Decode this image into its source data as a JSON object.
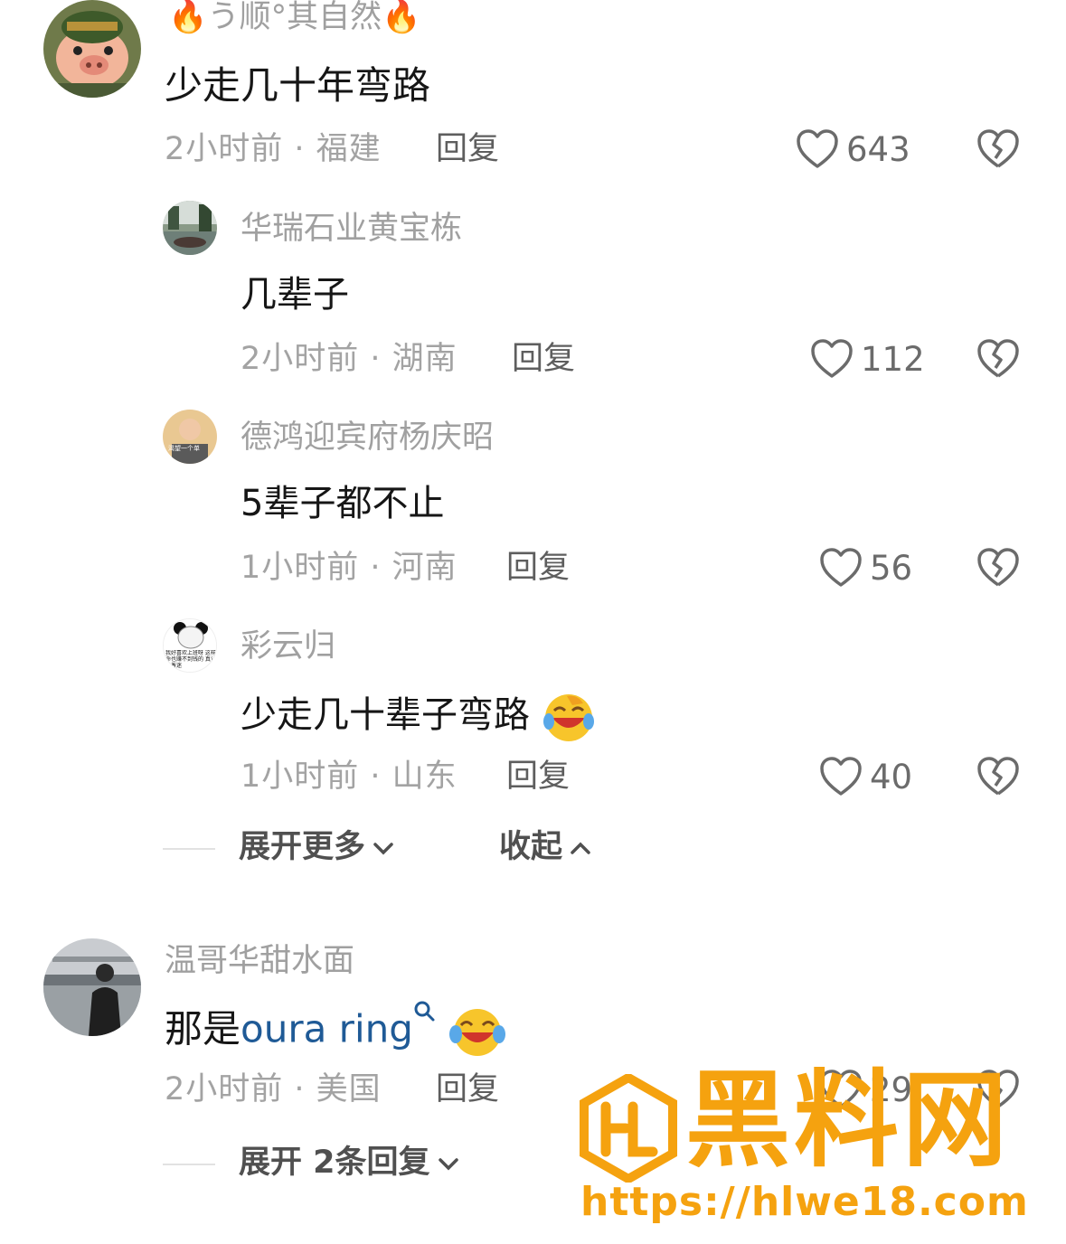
{
  "comments": [
    {
      "username_prefix": "🔥",
      "username": "う顺°其自然",
      "username_suffix": "🔥",
      "content": "少走几十年弯路",
      "meta": "2小时前 · 福建",
      "reply_label": "回复",
      "likes": "643"
    }
  ],
  "replies": [
    {
      "username": "华瑞石业黄宝栋",
      "content": "几辈子",
      "meta": "2小时前 · 湖南",
      "reply_label": "回复",
      "likes": "112"
    },
    {
      "username": "德鸿迎宾府杨庆昭",
      "avatar_caption": "渴望一个单",
      "content": "5辈子都不止",
      "meta": "1小时前 · 河南",
      "reply_label": "回复",
      "likes": "56"
    },
    {
      "username": "彩云归",
      "avatar_caption": "我好喜欢上班呀 这样命也赚不到钱的 真让人着迷",
      "content": "少走几十辈子弯路",
      "meta": "1小时前 · 山东",
      "reply_label": "回复",
      "likes": "40"
    }
  ],
  "expand_more": "展开更多",
  "collapse": "收起",
  "comment2": {
    "username": "温哥华甜水面",
    "content_prefix": "那是",
    "content_link": "oura ring",
    "meta": "2小时前 · 美国",
    "reply_label": "回复",
    "likes": "29"
  },
  "expand_replies": "展开 2条回复",
  "watermark": {
    "title": "黑料网",
    "url": "https://hlwe18.com"
  },
  "colors": {
    "username": "#a0a0a0",
    "link": "#1f5a96",
    "watermark": "#f5a20f"
  }
}
